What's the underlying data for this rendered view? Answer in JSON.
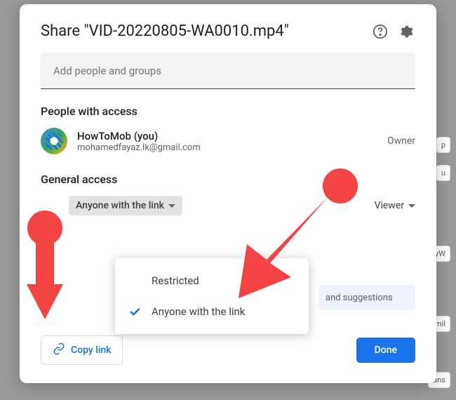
{
  "bg": {
    "frag1": "p",
    "frag2": "u",
    "frag3": "yW",
    "frag4": "mil",
    "frag5": "ans"
  },
  "header": {
    "title": "Share \"VID-20220805-WA0010.mp4\""
  },
  "input": {
    "placeholder": "Add people and groups"
  },
  "sections": {
    "people": "People with access",
    "general": "General access"
  },
  "person": {
    "name": "HowToMob (you)",
    "email": "mohamedfayaz.lk@gmail.com",
    "role": "Owner"
  },
  "access": {
    "selected": "Anyone with the link",
    "options": [
      "Restricted",
      "Anyone with the link"
    ],
    "role": "Viewer"
  },
  "message_hint": "and suggestions",
  "footer": {
    "copy_link": "Copy link",
    "done": "Done"
  },
  "colors": {
    "accent": "#1a73e8",
    "arrow": "#f44343"
  }
}
